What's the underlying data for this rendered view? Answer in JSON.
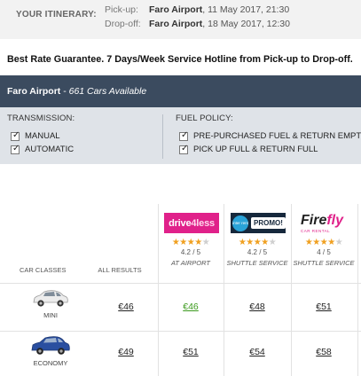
{
  "itinerary": {
    "label": "YOUR ITINERARY:",
    "pickup_key": "Pick-up:",
    "pickup_place": "Faro Airport",
    "pickup_time": ", 11 May 2017, 21:30",
    "dropoff_key": "Drop-off:",
    "dropoff_place": "Faro Airport",
    "dropoff_time": ", 18 May 2017, 12:30"
  },
  "promo": "Best Rate Guarantee. 7 Days/Week Service Hotline from Pick-up to Drop-off.",
  "location_bar": {
    "place": "Faro Airport",
    "sep": " - ",
    "count": "661 Cars Available"
  },
  "filters": {
    "transmission_title": "TRANSMISSION:",
    "transmission": [
      "MANUAL",
      "AUTOMATIC"
    ],
    "fuel_title": "FUEL POLICY:",
    "fuel": [
      "PRE-PURCHASED FUEL & RETURN EMPTY",
      "PICK UP FULL & RETURN FULL"
    ]
  },
  "table": {
    "header_car_classes": "CAR CLASSES",
    "header_all_results": "ALL RESULTS",
    "suppliers": [
      {
        "logo_text_a": "drive",
        "logo_text_b": "4less",
        "rating": "4.2 / 5",
        "stars": 4,
        "location": "AT AIRPORT",
        "logo_icon": "drive4less-logo"
      },
      {
        "logo_text_a": "inter rent",
        "logo_text_b": "PROMO!",
        "rating": "4.2 / 5",
        "stars": 4,
        "location": "SHUTTLE SERVICE",
        "logo_icon": "interrent-logo"
      },
      {
        "logo_text_a": "Fire",
        "logo_text_b": "fly",
        "logo_sub": "CAR RENTAL",
        "rating": "4 / 5",
        "stars": 4,
        "location": "SHUTTLE SERVICE",
        "logo_icon": "firefly-logo"
      }
    ],
    "rows": [
      {
        "class": "MINI",
        "car_color": "#ececec",
        "all": "€46",
        "prices": [
          "€46",
          "€48",
          "€51"
        ]
      },
      {
        "class": "ECONOMY",
        "car_color": "#2a4fa0",
        "all": "€49",
        "prices": [
          "€51",
          "€54",
          "€58"
        ]
      }
    ]
  }
}
